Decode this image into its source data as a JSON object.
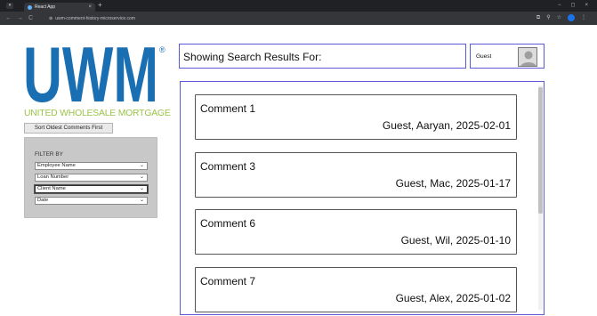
{
  "browser": {
    "tab_title": "React App",
    "tab_close": "×",
    "new_tab": "+",
    "url": "uwm-comment-history-microservice.com",
    "nav_back": "←",
    "nav_forward": "→",
    "nav_reload": "C",
    "site_info": "⊕",
    "win_minimize": "−",
    "win_restore": "◻",
    "win_close": "×",
    "icons": [
      "cast-icon",
      "zoom-icon",
      "star-icon",
      "profile-icon",
      "menu-icon"
    ]
  },
  "brand": {
    "logo_text": "UWM",
    "logo_mark": "®",
    "tagline": "UNITED WHOLESALE MORTGAGE",
    "logo_color": "#1a6fb3",
    "tagline_color": "#9cc44a"
  },
  "sidebar": {
    "sort_button": "Sort Oldest Comments First",
    "filter_title": "FILTER BY",
    "filters": [
      {
        "label": "Employee Name"
      },
      {
        "label": "Loan Number"
      },
      {
        "label": "Client Name"
      },
      {
        "label": "Date"
      }
    ]
  },
  "header": {
    "search_results_label": "Showing Search Results For:",
    "user_name": "Guest"
  },
  "comments": [
    {
      "title": "Comment 1",
      "meta": "Guest, Aaryan, 2025-02-01"
    },
    {
      "title": "Comment 3",
      "meta": "Guest, Mac, 2025-01-17"
    },
    {
      "title": "Comment 6",
      "meta": "Guest, Wil, 2025-01-10"
    },
    {
      "title": "Comment 7",
      "meta": "Guest, Alex, 2025-01-02"
    }
  ],
  "colors": {
    "accent_border": "#5b5bd6",
    "panel_gray": "#c8c8c8"
  }
}
